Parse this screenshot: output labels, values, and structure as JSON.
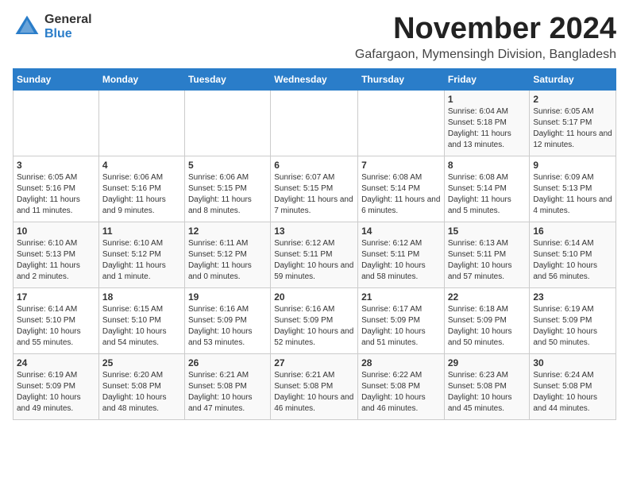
{
  "logo": {
    "general": "General",
    "blue": "Blue"
  },
  "header": {
    "month": "November 2024",
    "location": "Gafargaon, Mymensingh Division, Bangladesh"
  },
  "weekdays": [
    "Sunday",
    "Monday",
    "Tuesday",
    "Wednesday",
    "Thursday",
    "Friday",
    "Saturday"
  ],
  "weeks": [
    [
      {
        "day": "",
        "content": ""
      },
      {
        "day": "",
        "content": ""
      },
      {
        "day": "",
        "content": ""
      },
      {
        "day": "",
        "content": ""
      },
      {
        "day": "",
        "content": ""
      },
      {
        "day": "1",
        "content": "Sunrise: 6:04 AM\nSunset: 5:18 PM\nDaylight: 11 hours and 13 minutes."
      },
      {
        "day": "2",
        "content": "Sunrise: 6:05 AM\nSunset: 5:17 PM\nDaylight: 11 hours and 12 minutes."
      }
    ],
    [
      {
        "day": "3",
        "content": "Sunrise: 6:05 AM\nSunset: 5:16 PM\nDaylight: 11 hours and 11 minutes."
      },
      {
        "day": "4",
        "content": "Sunrise: 6:06 AM\nSunset: 5:16 PM\nDaylight: 11 hours and 9 minutes."
      },
      {
        "day": "5",
        "content": "Sunrise: 6:06 AM\nSunset: 5:15 PM\nDaylight: 11 hours and 8 minutes."
      },
      {
        "day": "6",
        "content": "Sunrise: 6:07 AM\nSunset: 5:15 PM\nDaylight: 11 hours and 7 minutes."
      },
      {
        "day": "7",
        "content": "Sunrise: 6:08 AM\nSunset: 5:14 PM\nDaylight: 11 hours and 6 minutes."
      },
      {
        "day": "8",
        "content": "Sunrise: 6:08 AM\nSunset: 5:14 PM\nDaylight: 11 hours and 5 minutes."
      },
      {
        "day": "9",
        "content": "Sunrise: 6:09 AM\nSunset: 5:13 PM\nDaylight: 11 hours and 4 minutes."
      }
    ],
    [
      {
        "day": "10",
        "content": "Sunrise: 6:10 AM\nSunset: 5:13 PM\nDaylight: 11 hours and 2 minutes."
      },
      {
        "day": "11",
        "content": "Sunrise: 6:10 AM\nSunset: 5:12 PM\nDaylight: 11 hours and 1 minute."
      },
      {
        "day": "12",
        "content": "Sunrise: 6:11 AM\nSunset: 5:12 PM\nDaylight: 11 hours and 0 minutes."
      },
      {
        "day": "13",
        "content": "Sunrise: 6:12 AM\nSunset: 5:11 PM\nDaylight: 10 hours and 59 minutes."
      },
      {
        "day": "14",
        "content": "Sunrise: 6:12 AM\nSunset: 5:11 PM\nDaylight: 10 hours and 58 minutes."
      },
      {
        "day": "15",
        "content": "Sunrise: 6:13 AM\nSunset: 5:11 PM\nDaylight: 10 hours and 57 minutes."
      },
      {
        "day": "16",
        "content": "Sunrise: 6:14 AM\nSunset: 5:10 PM\nDaylight: 10 hours and 56 minutes."
      }
    ],
    [
      {
        "day": "17",
        "content": "Sunrise: 6:14 AM\nSunset: 5:10 PM\nDaylight: 10 hours and 55 minutes."
      },
      {
        "day": "18",
        "content": "Sunrise: 6:15 AM\nSunset: 5:10 PM\nDaylight: 10 hours and 54 minutes."
      },
      {
        "day": "19",
        "content": "Sunrise: 6:16 AM\nSunset: 5:09 PM\nDaylight: 10 hours and 53 minutes."
      },
      {
        "day": "20",
        "content": "Sunrise: 6:16 AM\nSunset: 5:09 PM\nDaylight: 10 hours and 52 minutes."
      },
      {
        "day": "21",
        "content": "Sunrise: 6:17 AM\nSunset: 5:09 PM\nDaylight: 10 hours and 51 minutes."
      },
      {
        "day": "22",
        "content": "Sunrise: 6:18 AM\nSunset: 5:09 PM\nDaylight: 10 hours and 50 minutes."
      },
      {
        "day": "23",
        "content": "Sunrise: 6:19 AM\nSunset: 5:09 PM\nDaylight: 10 hours and 50 minutes."
      }
    ],
    [
      {
        "day": "24",
        "content": "Sunrise: 6:19 AM\nSunset: 5:09 PM\nDaylight: 10 hours and 49 minutes."
      },
      {
        "day": "25",
        "content": "Sunrise: 6:20 AM\nSunset: 5:08 PM\nDaylight: 10 hours and 48 minutes."
      },
      {
        "day": "26",
        "content": "Sunrise: 6:21 AM\nSunset: 5:08 PM\nDaylight: 10 hours and 47 minutes."
      },
      {
        "day": "27",
        "content": "Sunrise: 6:21 AM\nSunset: 5:08 PM\nDaylight: 10 hours and 46 minutes."
      },
      {
        "day": "28",
        "content": "Sunrise: 6:22 AM\nSunset: 5:08 PM\nDaylight: 10 hours and 46 minutes."
      },
      {
        "day": "29",
        "content": "Sunrise: 6:23 AM\nSunset: 5:08 PM\nDaylight: 10 hours and 45 minutes."
      },
      {
        "day": "30",
        "content": "Sunrise: 6:24 AM\nSunset: 5:08 PM\nDaylight: 10 hours and 44 minutes."
      }
    ]
  ]
}
